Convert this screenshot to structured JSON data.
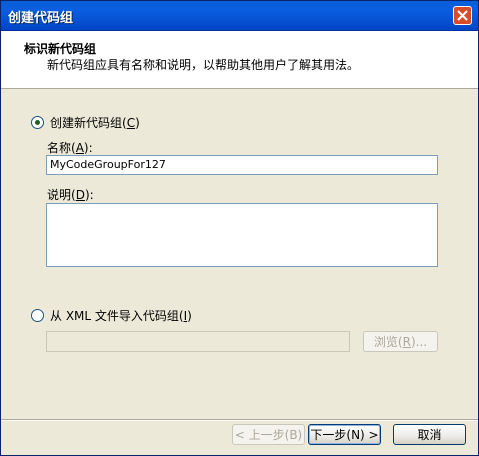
{
  "window": {
    "title": "创建代码组"
  },
  "header": {
    "title": "标识新代码组",
    "subtitle": "新代码组应具有名称和说明，以帮助其他用户了解其用法。"
  },
  "option_create": {
    "label_prefix": "创建新代码组(",
    "label_accel": "C",
    "label_suffix": ")",
    "checked": true
  },
  "name_field": {
    "label_prefix": "名称(",
    "label_accel": "A",
    "label_suffix": "):",
    "value": "MyCodeGroupFor127"
  },
  "description_field": {
    "label_prefix": "说明(",
    "label_accel": "D",
    "label_suffix": "):",
    "value": ""
  },
  "option_import": {
    "label_prefix": "从 XML 文件导入代码组(",
    "label_accel": "I",
    "label_suffix": ")",
    "checked": false
  },
  "import_path": {
    "value": ""
  },
  "browse_button": {
    "label_prefix": "浏览(",
    "label_accel": "R",
    "label_suffix": ")..."
  },
  "footer": {
    "back_label": "< 上一步(B)",
    "next_label": "下一步(N) >",
    "cancel_label": "取消"
  }
}
